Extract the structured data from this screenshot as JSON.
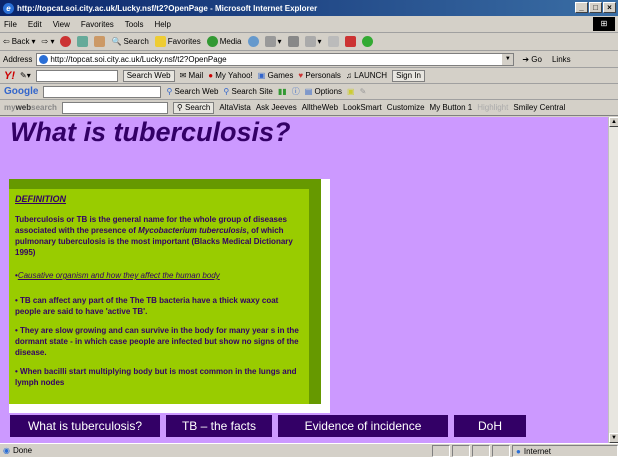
{
  "window": {
    "title": "http://topcat.soi.city.ac.uk/Lucky.nsf/t2?OpenPage - Microsoft Internet Explorer"
  },
  "menu": [
    "File",
    "Edit",
    "View",
    "Favorites",
    "Tools",
    "Help"
  ],
  "toolbar": {
    "back": "Back",
    "search": "Search",
    "favorites": "Favorites",
    "media": "Media"
  },
  "address": {
    "label": "Address",
    "url": "http://topcat.soi.city.ac.uk/Lucky.nsf/t2?OpenPage",
    "go": "Go",
    "links": "Links"
  },
  "yahoo": {
    "logo": "Y!",
    "search_web": "Search Web",
    "mail": "Mail",
    "my_yahoo": "My Yahoo!",
    "games": "Games",
    "personals": "Personals",
    "launch": "LAUNCH",
    "sign_in": "Sign In"
  },
  "google": {
    "logo": "Google",
    "search_web": "Search Web",
    "search_site": "Search Site",
    "options": "Options"
  },
  "mws": {
    "logo_pre": "my",
    "logo_bold": "web",
    "logo_post": "search",
    "search": "Search",
    "items": [
      "AltaVista",
      "Ask Jeeves",
      "AlltheWeb",
      "LookSmart",
      "Customize",
      "My Button 1",
      "Highlight",
      "Smiley Central"
    ]
  },
  "page": {
    "title": "What is tuberculosis?",
    "definition_heading": "DEFINITION",
    "definition_intro": "Tuberculosis or TB is the general name for the whole group of diseases associated with the presence of ",
    "definition_organism": "Mycobacterium tuberculosis",
    "definition_rest": ", of which pulmonary tuberculosis is the most important (Blacks Medical Dictionary 1995)",
    "cause_bullet": "•",
    "cause_link": "Causative organism and how they affect the human body",
    "bullets": [
      "• TB can affect any part of the The TB bacteria have a thick waxy coat people are said to have 'active TB'.",
      "• They are slow growing and can survive in the body for many year s in the dormant state - in which case people are infected but show no signs of the disease.",
      "• When bacilli start multiplying body but is most common in the lungs and lymph nodes"
    ],
    "nav": [
      "What is tuberculosis?",
      "TB – the facts",
      "Evidence of incidence",
      "DoH"
    ]
  },
  "status": {
    "left": "Done",
    "zone": "Internet"
  },
  "colors": {
    "page_bg": "#cc99ff",
    "panel_bg": "#99cc00",
    "panel_shadow": "#669900",
    "nav_bg": "#330066",
    "title_color": "#330066"
  }
}
